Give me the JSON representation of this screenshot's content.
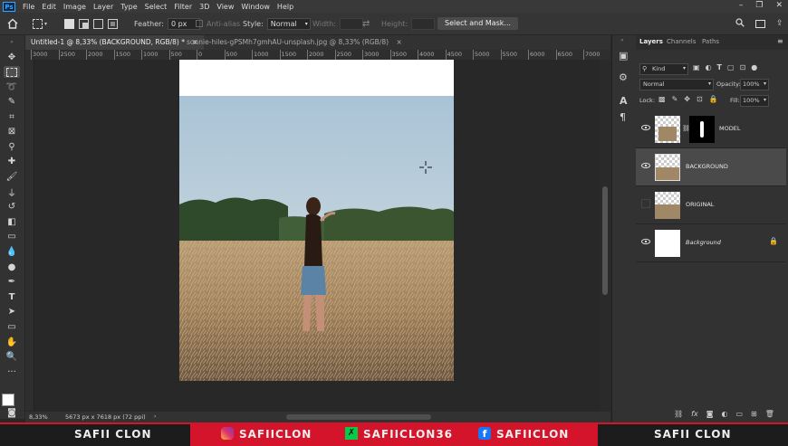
{
  "app": {
    "name": "Ps"
  },
  "menu": [
    "File",
    "Edit",
    "Image",
    "Layer",
    "Type",
    "Select",
    "Filter",
    "3D",
    "View",
    "Window",
    "Help"
  ],
  "options": {
    "feather_label": "Feather:",
    "feather_value": "0 px",
    "antialias_label": "Anti-alias",
    "style_label": "Style:",
    "style_value": "Normal",
    "width_label": "Width:",
    "height_label": "Height:",
    "select_mask": "Select and Mask..."
  },
  "tabs": [
    {
      "label": "Untitled-1 @ 8,33% (BACKGROUND, RGB/8) *",
      "close": "×"
    },
    {
      "label": "sonnie-hiles-gPSMh7gmhAU-unsplash.jpg @ 8,33% (RGB/8)",
      "close": "×"
    }
  ],
  "ruler_h": [
    "3000",
    "2500",
    "2000",
    "1500",
    "1000",
    "500",
    "0",
    "500",
    "1000",
    "1500",
    "2000",
    "2500",
    "3000",
    "3500",
    "4000",
    "4500",
    "5000",
    "5500",
    "6000",
    "6500",
    "7000",
    "7500",
    "8000",
    "8500"
  ],
  "status": {
    "zoom": "8,33%",
    "doc": "5673 px x 7618 px (72 ppi)"
  },
  "panel": {
    "tabs": [
      "Layers",
      "Channels",
      "Paths"
    ],
    "kind": "Kind",
    "blend": "Normal",
    "opacity_label": "Opacity:",
    "opacity_value": "100%",
    "lock_label": "Lock:",
    "fill_label": "Fill:",
    "fill_value": "100%"
  },
  "layers": [
    {
      "name": "MODEL",
      "visible": true,
      "mask": true
    },
    {
      "name": "BACKGROUND",
      "visible": true,
      "selected": true
    },
    {
      "name": "ORIGINAL",
      "visible": false
    },
    {
      "name": "Background",
      "visible": true,
      "locked": true
    }
  ],
  "banner": {
    "left": "SAFII CLON",
    "instagram": "SAFIICLON",
    "deviantart": "SAFIICLON36",
    "facebook": "SAFIICLON",
    "right": "SAFII CLON"
  },
  "colors": {
    "accent": "#31a8ff",
    "banner_red": "#d4142a",
    "panel": "#323232"
  }
}
